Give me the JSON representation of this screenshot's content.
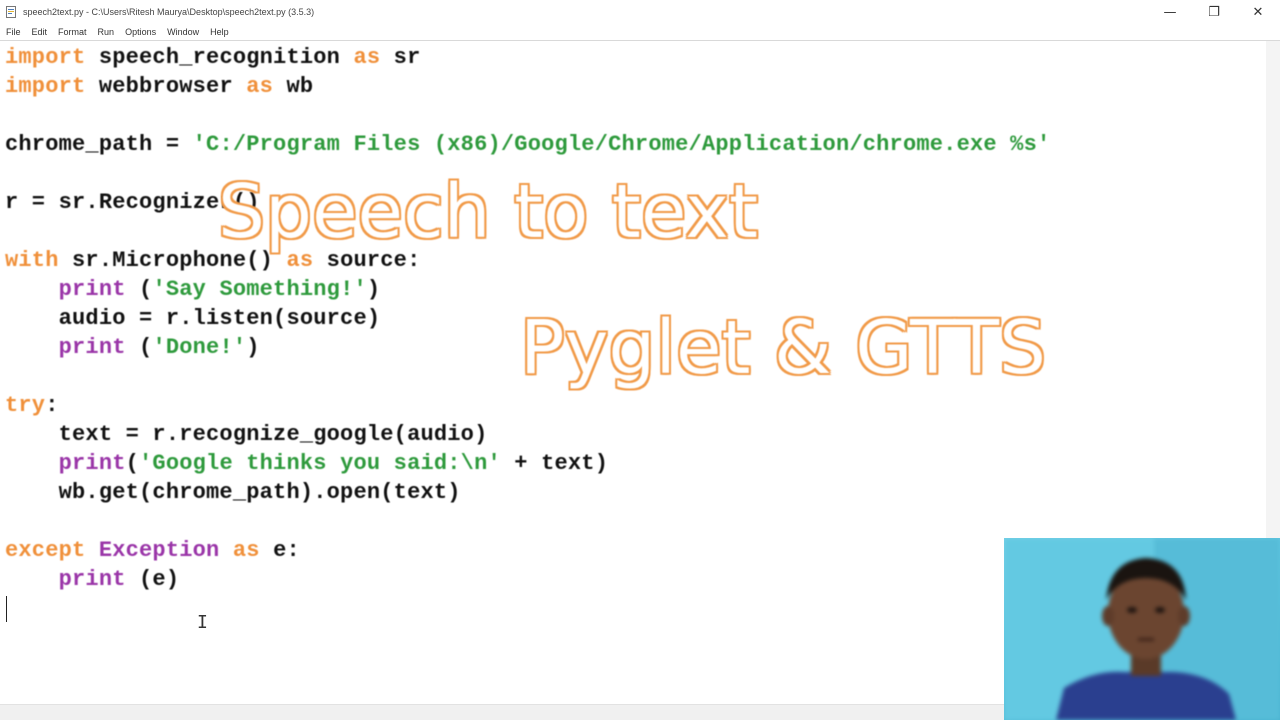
{
  "window": {
    "title": "speech2text.py - C:\\Users\\Ritesh Maurya\\Desktop\\speech2text.py (3.5.3)",
    "controls": {
      "minimize": "—",
      "restore": "❐",
      "close": "✕"
    }
  },
  "menu": [
    "File",
    "Edit",
    "Format",
    "Run",
    "Options",
    "Window",
    "Help"
  ],
  "code": {
    "l1": {
      "kw1": "import",
      "mod": " speech_recognition ",
      "kw2": "as",
      "alias": " sr"
    },
    "l2": {
      "kw1": "import",
      "mod": " webbrowser ",
      "kw2": "as",
      "alias": " wb"
    },
    "l3": {
      "var": "chrome_path = ",
      "str": "'C:/Program Files (x86)/Google/Chrome/Application/chrome.exe %s'"
    },
    "l4": {
      "text": "r = sr.Recognizer()"
    },
    "l5": {
      "kw1": "with",
      "mid": " sr.Microphone() ",
      "kw2": "as",
      "end": " source:"
    },
    "l6": {
      "indent": "    ",
      "fn": "print",
      "open": " (",
      "str": "'Say Something!'",
      "close": ")"
    },
    "l7": {
      "text": "    audio = r.listen(source)"
    },
    "l8": {
      "indent": "    ",
      "fn": "print",
      "open": " (",
      "str": "'Done!'",
      "close": ")"
    },
    "l9": {
      "kw": "try",
      "end": ":"
    },
    "l10": {
      "text": "    text = r.recognize_google(audio)"
    },
    "l11": {
      "indent": "    ",
      "fn": "print",
      "open": "(",
      "str": "'Google thinks you said:\\n'",
      "close": " + text)"
    },
    "l12": {
      "text": "    wb.get(chrome_path).open(text)"
    },
    "l13": {
      "kw1": "except",
      "sp": " ",
      "cls": "Exception",
      "sp2": " ",
      "kw2": "as",
      "end": " e:"
    },
    "l14": {
      "indent": "    ",
      "fn": "print",
      "close": " (e)"
    }
  },
  "overlay": {
    "line1": "Speech to text",
    "line2": "Pyglet & GTTS"
  },
  "colors": {
    "keyword": "#f0903a",
    "builtin": "#9a35a8",
    "string": "#2e9a3c",
    "overlay_outline": "#f19a48"
  }
}
